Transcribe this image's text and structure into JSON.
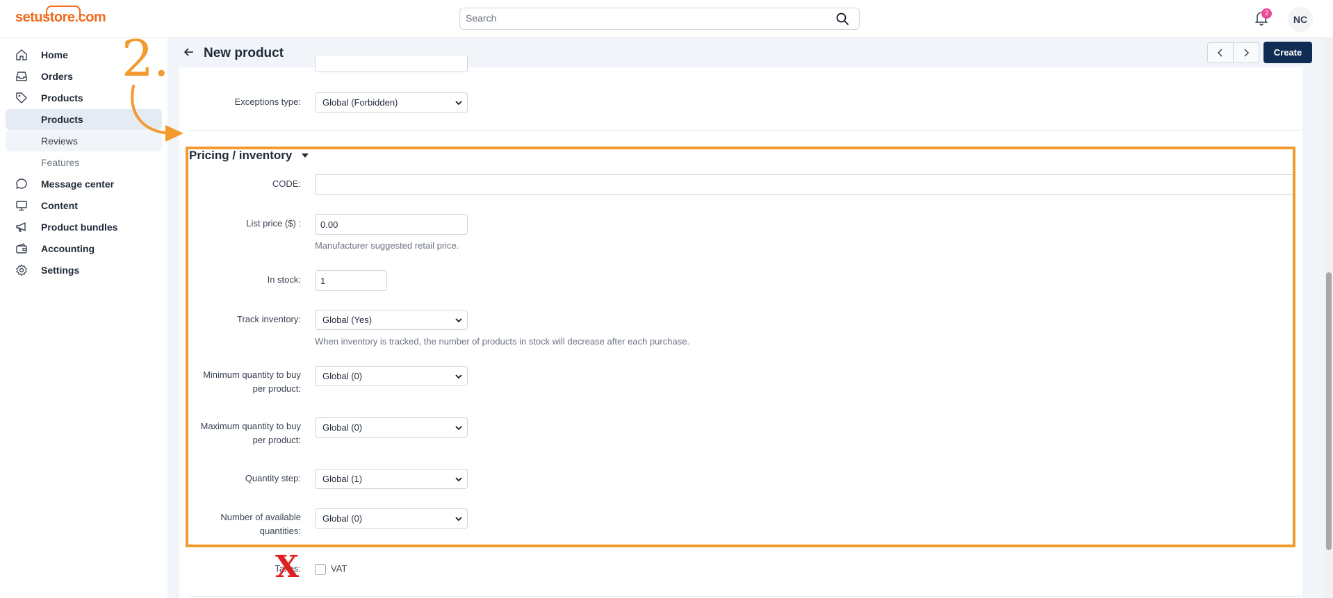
{
  "app": {
    "logo_text": "setustore.com",
    "brand_color": "#f26b1d"
  },
  "topbar": {
    "search_placeholder": "Search",
    "notifications_count": "2",
    "user_initials": "NC"
  },
  "sidebar": {
    "items": [
      {
        "label": "Home",
        "icon": "home-icon"
      },
      {
        "label": "Orders",
        "icon": "inbox-icon"
      },
      {
        "label": "Products",
        "icon": "tag-icon"
      },
      {
        "label": "Products",
        "sub": true,
        "active": true
      },
      {
        "label": "Reviews",
        "sub": true
      },
      {
        "label": "Features",
        "sub": true,
        "muted": true
      },
      {
        "label": "Message center",
        "icon": "chat-icon"
      },
      {
        "label": "Content",
        "icon": "monitor-icon"
      },
      {
        "label": "Product bundles",
        "icon": "megaphone-icon"
      },
      {
        "label": "Accounting",
        "icon": "wallet-icon"
      },
      {
        "label": "Settings",
        "icon": "gear-icon"
      }
    ]
  },
  "header": {
    "title": "New product",
    "create_label": "Create"
  },
  "form": {
    "exceptions_type": {
      "label": "Exceptions type:",
      "value": "Global (Forbidden)"
    },
    "section_title": "Pricing / inventory",
    "code": {
      "label": "CODE:",
      "value": ""
    },
    "list_price": {
      "label": "List price ($) :",
      "value": "0.00",
      "help": "Manufacturer suggested retail price."
    },
    "in_stock": {
      "label": "In stock:",
      "value": "1"
    },
    "track_inventory": {
      "label": "Track inventory:",
      "value": "Global (Yes)",
      "help": "When inventory is tracked, the number of products in stock will decrease after each purchase."
    },
    "min_qty": {
      "label_line1": "Minimum quantity to buy",
      "label_line2": "per product:",
      "value": "Global (0)"
    },
    "max_qty": {
      "label_line1": "Maximum quantity to buy",
      "label_line2": "per product:",
      "value": "Global (0)"
    },
    "qty_step": {
      "label": "Quantity step:",
      "value": "Global (1)"
    },
    "available_qty": {
      "label_line1": "Number of available",
      "label_line2": "quantities:",
      "value": "Global (0)"
    },
    "taxes": {
      "label": "Taxes:",
      "vat_label": "VAT"
    }
  },
  "annotations": {
    "step_number": "2.",
    "highlight_color": "#f39a2e",
    "x_mark": "X",
    "x_color": "#e02020"
  }
}
